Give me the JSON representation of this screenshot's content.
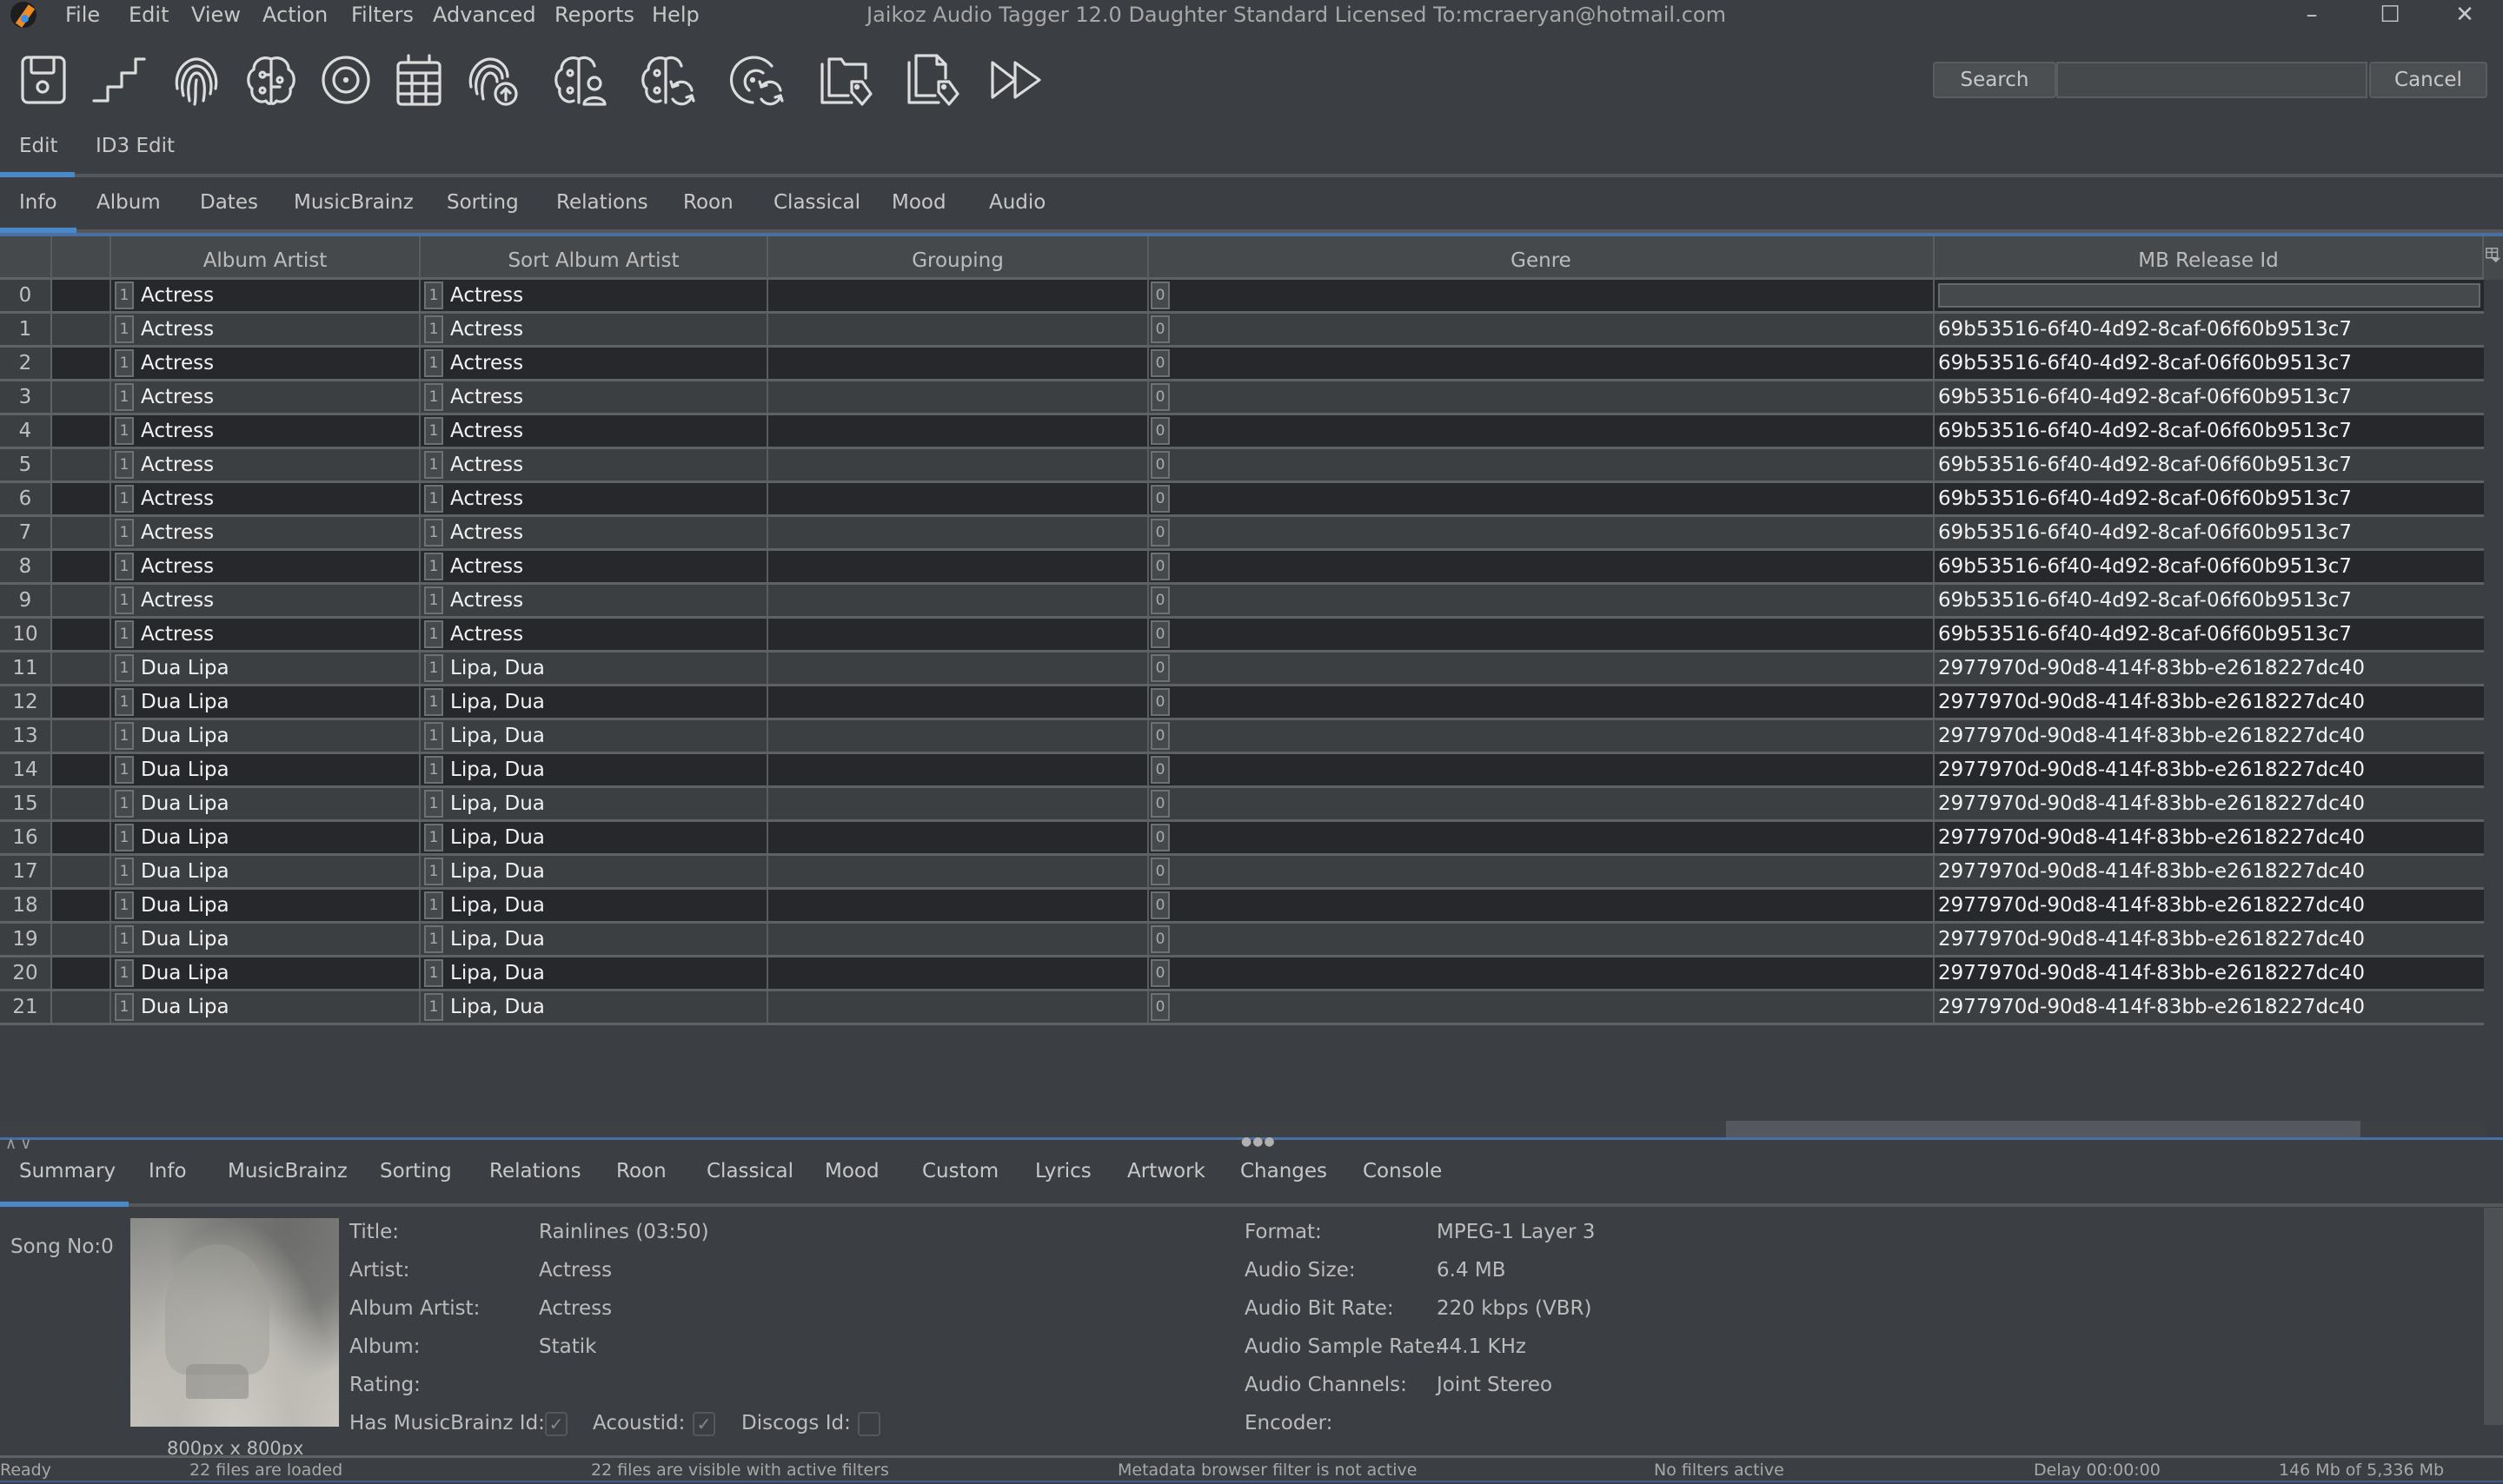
{
  "window": {
    "title": "Jaikoz Audio Tagger 12.0 Daughter Standard Licensed To:mcraeryan@hotmail.com",
    "controls": [
      "minimize",
      "maximize",
      "close"
    ]
  },
  "menu": [
    "File",
    "Edit",
    "View",
    "Action",
    "Filters",
    "Advanced",
    "Reports",
    "Help"
  ],
  "toolbar": {
    "icons": [
      "save-icon",
      "stairs-icon",
      "fingerprint-icon",
      "brain-icon",
      "target-icon",
      "calendar-icon",
      "fingerprint-upload-icon",
      "brain-user-icon",
      "brain-refresh-icon",
      "target-refresh-icon",
      "folder-tag-icon",
      "file-tag-icon",
      "fast-forward-icon"
    ],
    "search_label": "Search",
    "search_value": "",
    "cancel_label": "Cancel"
  },
  "edit_tabs": {
    "items": [
      "Edit",
      "ID3 Edit"
    ],
    "active": "Edit"
  },
  "field_tabs": {
    "items": [
      "Info",
      "Album",
      "Dates",
      "MusicBrainz",
      "Sorting",
      "Relations",
      "Roon",
      "Classical",
      "Mood",
      "Audio"
    ],
    "active": "Info"
  },
  "table": {
    "columns": [
      "",
      "",
      "Album Artist",
      "Sort Album Artist",
      "Grouping",
      "Genre",
      "MB Release Id"
    ],
    "rows": [
      {
        "n": "0",
        "album_artist": "Actress",
        "aa_count": "1",
        "sort_album_artist": "Actress",
        "saa_count": "1",
        "grouping": "",
        "genre": "",
        "genre_count": "0",
        "mb_release_id": ""
      },
      {
        "n": "1",
        "album_artist": "Actress",
        "aa_count": "1",
        "sort_album_artist": "Actress",
        "saa_count": "1",
        "grouping": "",
        "genre": "",
        "genre_count": "0",
        "mb_release_id": "69b53516-6f40-4d92-8caf-06f60b9513c7"
      },
      {
        "n": "2",
        "album_artist": "Actress",
        "aa_count": "1",
        "sort_album_artist": "Actress",
        "saa_count": "1",
        "grouping": "",
        "genre": "",
        "genre_count": "0",
        "mb_release_id": "69b53516-6f40-4d92-8caf-06f60b9513c7"
      },
      {
        "n": "3",
        "album_artist": "Actress",
        "aa_count": "1",
        "sort_album_artist": "Actress",
        "saa_count": "1",
        "grouping": "",
        "genre": "",
        "genre_count": "0",
        "mb_release_id": "69b53516-6f40-4d92-8caf-06f60b9513c7"
      },
      {
        "n": "4",
        "album_artist": "Actress",
        "aa_count": "1",
        "sort_album_artist": "Actress",
        "saa_count": "1",
        "grouping": "",
        "genre": "",
        "genre_count": "0",
        "mb_release_id": "69b53516-6f40-4d92-8caf-06f60b9513c7"
      },
      {
        "n": "5",
        "album_artist": "Actress",
        "aa_count": "1",
        "sort_album_artist": "Actress",
        "saa_count": "1",
        "grouping": "",
        "genre": "",
        "genre_count": "0",
        "mb_release_id": "69b53516-6f40-4d92-8caf-06f60b9513c7"
      },
      {
        "n": "6",
        "album_artist": "Actress",
        "aa_count": "1",
        "sort_album_artist": "Actress",
        "saa_count": "1",
        "grouping": "",
        "genre": "",
        "genre_count": "0",
        "mb_release_id": "69b53516-6f40-4d92-8caf-06f60b9513c7"
      },
      {
        "n": "7",
        "album_artist": "Actress",
        "aa_count": "1",
        "sort_album_artist": "Actress",
        "saa_count": "1",
        "grouping": "",
        "genre": "",
        "genre_count": "0",
        "mb_release_id": "69b53516-6f40-4d92-8caf-06f60b9513c7"
      },
      {
        "n": "8",
        "album_artist": "Actress",
        "aa_count": "1",
        "sort_album_artist": "Actress",
        "saa_count": "1",
        "grouping": "",
        "genre": "",
        "genre_count": "0",
        "mb_release_id": "69b53516-6f40-4d92-8caf-06f60b9513c7"
      },
      {
        "n": "9",
        "album_artist": "Actress",
        "aa_count": "1",
        "sort_album_artist": "Actress",
        "saa_count": "1",
        "grouping": "",
        "genre": "",
        "genre_count": "0",
        "mb_release_id": "69b53516-6f40-4d92-8caf-06f60b9513c7"
      },
      {
        "n": "10",
        "album_artist": "Actress",
        "aa_count": "1",
        "sort_album_artist": "Actress",
        "saa_count": "1",
        "grouping": "",
        "genre": "",
        "genre_count": "0",
        "mb_release_id": "69b53516-6f40-4d92-8caf-06f60b9513c7"
      },
      {
        "n": "11",
        "album_artist": "Dua Lipa",
        "aa_count": "1",
        "sort_album_artist": "Lipa, Dua",
        "saa_count": "1",
        "grouping": "",
        "genre": "",
        "genre_count": "0",
        "mb_release_id": "2977970d-90d8-414f-83bb-e2618227dc40"
      },
      {
        "n": "12",
        "album_artist": "Dua Lipa",
        "aa_count": "1",
        "sort_album_artist": "Lipa, Dua",
        "saa_count": "1",
        "grouping": "",
        "genre": "",
        "genre_count": "0",
        "mb_release_id": "2977970d-90d8-414f-83bb-e2618227dc40"
      },
      {
        "n": "13",
        "album_artist": "Dua Lipa",
        "aa_count": "1",
        "sort_album_artist": "Lipa, Dua",
        "saa_count": "1",
        "grouping": "",
        "genre": "",
        "genre_count": "0",
        "mb_release_id": "2977970d-90d8-414f-83bb-e2618227dc40"
      },
      {
        "n": "14",
        "album_artist": "Dua Lipa",
        "aa_count": "1",
        "sort_album_artist": "Lipa, Dua",
        "saa_count": "1",
        "grouping": "",
        "genre": "",
        "genre_count": "0",
        "mb_release_id": "2977970d-90d8-414f-83bb-e2618227dc40"
      },
      {
        "n": "15",
        "album_artist": "Dua Lipa",
        "aa_count": "1",
        "sort_album_artist": "Lipa, Dua",
        "saa_count": "1",
        "grouping": "",
        "genre": "",
        "genre_count": "0",
        "mb_release_id": "2977970d-90d8-414f-83bb-e2618227dc40"
      },
      {
        "n": "16",
        "album_artist": "Dua Lipa",
        "aa_count": "1",
        "sort_album_artist": "Lipa, Dua",
        "saa_count": "1",
        "grouping": "",
        "genre": "",
        "genre_count": "0",
        "mb_release_id": "2977970d-90d8-414f-83bb-e2618227dc40"
      },
      {
        "n": "17",
        "album_artist": "Dua Lipa",
        "aa_count": "1",
        "sort_album_artist": "Lipa, Dua",
        "saa_count": "1",
        "grouping": "",
        "genre": "",
        "genre_count": "0",
        "mb_release_id": "2977970d-90d8-414f-83bb-e2618227dc40"
      },
      {
        "n": "18",
        "album_artist": "Dua Lipa",
        "aa_count": "1",
        "sort_album_artist": "Lipa, Dua",
        "saa_count": "1",
        "grouping": "",
        "genre": "",
        "genre_count": "0",
        "mb_release_id": "2977970d-90d8-414f-83bb-e2618227dc40"
      },
      {
        "n": "19",
        "album_artist": "Dua Lipa",
        "aa_count": "1",
        "sort_album_artist": "Lipa, Dua",
        "saa_count": "1",
        "grouping": "",
        "genre": "",
        "genre_count": "0",
        "mb_release_id": "2977970d-90d8-414f-83bb-e2618227dc40"
      },
      {
        "n": "20",
        "album_artist": "Dua Lipa",
        "aa_count": "1",
        "sort_album_artist": "Lipa, Dua",
        "saa_count": "1",
        "grouping": "",
        "genre": "",
        "genre_count": "0",
        "mb_release_id": "2977970d-90d8-414f-83bb-e2618227dc40"
      },
      {
        "n": "21",
        "album_artist": "Dua Lipa",
        "aa_count": "1",
        "sort_album_artist": "Lipa, Dua",
        "saa_count": "1",
        "grouping": "",
        "genre": "",
        "genre_count": "0",
        "mb_release_id": "2977970d-90d8-414f-83bb-e2618227dc40"
      }
    ],
    "column_chooser_icon": "column-chooser-icon"
  },
  "detail_tabs": {
    "items": [
      "Summary",
      "Info",
      "MusicBrainz",
      "Sorting",
      "Relations",
      "Roon",
      "Classical",
      "Mood",
      "Custom",
      "Lyrics",
      "Artwork",
      "Changes",
      "Console"
    ],
    "active": "Summary"
  },
  "summary": {
    "song_no": "Song No:0",
    "artwork_size": "800px x 800px",
    "left_fields": [
      {
        "label": "Title:",
        "value": "Rainlines (03:50)"
      },
      {
        "label": "Artist:",
        "value": "Actress"
      },
      {
        "label": "Album Artist:",
        "value": "Actress"
      },
      {
        "label": "Album:",
        "value": "Statik"
      },
      {
        "label": "Rating:",
        "value": ""
      }
    ],
    "checks": [
      {
        "label": "Has MusicBrainz Id:",
        "checked": true,
        "mark": "✓"
      },
      {
        "label": "Acoustid:",
        "checked": true,
        "mark": "✓"
      },
      {
        "label": "Discogs Id:",
        "checked": false,
        "mark": ""
      }
    ],
    "right_fields": [
      {
        "label": "Format:",
        "value": "MPEG-1 Layer 3"
      },
      {
        "label": "Audio Size:",
        "value": "6.4 MB"
      },
      {
        "label": "Audio Bit Rate:",
        "value": "220 kbps (VBR)"
      },
      {
        "label": "Audio Sample Rate:",
        "value": "44.1 KHz"
      },
      {
        "label": "Audio Channels:",
        "value": "Joint Stereo"
      },
      {
        "label": "Encoder:",
        "value": ""
      }
    ]
  },
  "status": {
    "state": "Ready",
    "loaded": "22 files are loaded",
    "visible": "22 files are visible with active filters",
    "browser_filter": "Metadata browser filter is not active",
    "filters": "No filters active",
    "delay": "Delay 00:00:00",
    "memory": "146 Mb of 5,336 Mb"
  },
  "colors": {
    "accent": "#4a88c7",
    "background": "#3b3e42",
    "row_dark": "#26282b",
    "row_light": "#3c3f42"
  }
}
